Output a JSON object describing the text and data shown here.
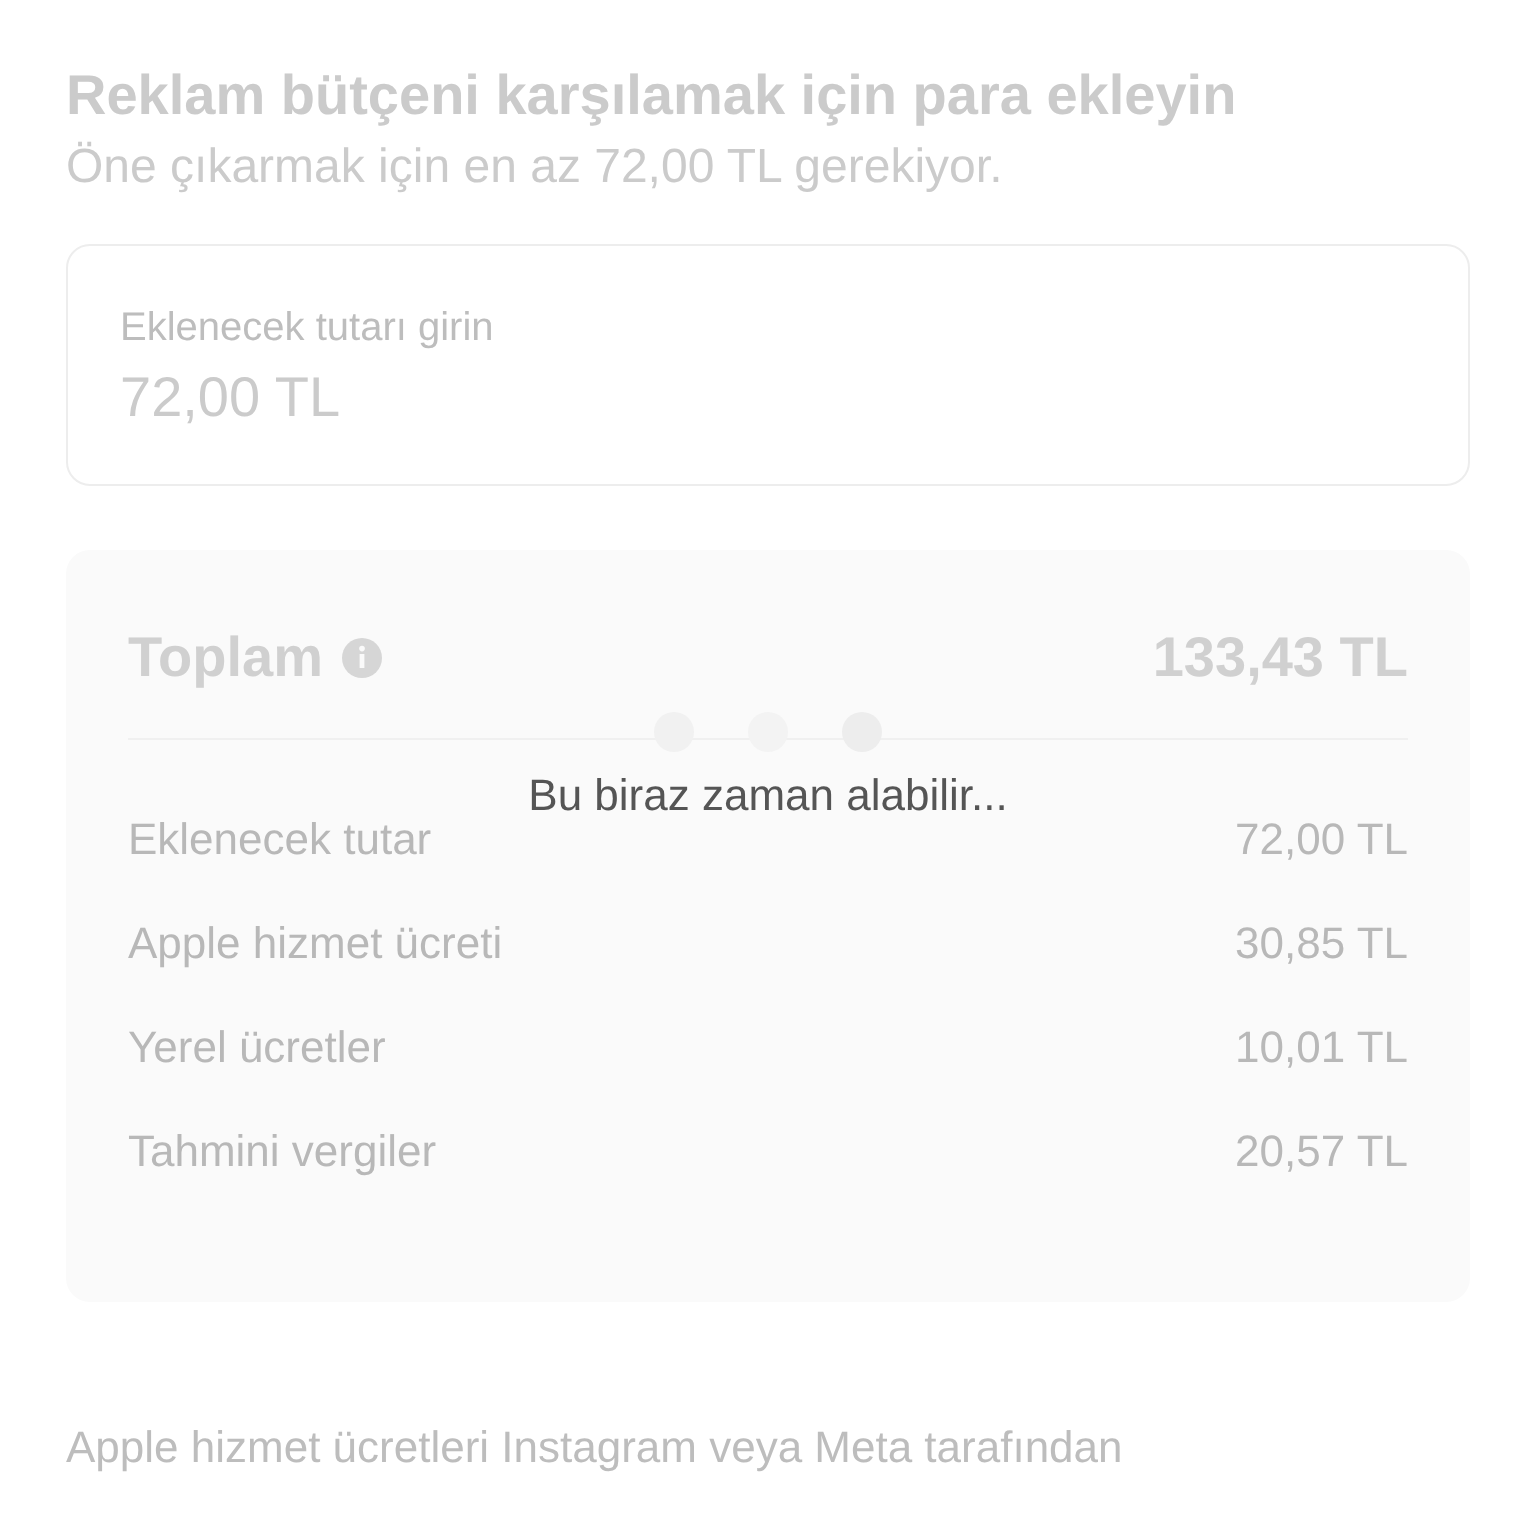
{
  "header": {
    "title": "Reklam bütçeni karşılamak için para ekleyin",
    "subtitle": "Öne çıkarmak için en az 72,00 TL gerekiyor."
  },
  "amount_field": {
    "label": "Eklenecek tutarı girin",
    "value": "72,00 TL"
  },
  "summary": {
    "total_label": "Toplam",
    "total_value": "133,43 TL",
    "rows": [
      {
        "label": "Eklenecek tutar",
        "value": "72,00 TL"
      },
      {
        "label": "Apple hizmet ücreti",
        "value": "30,85 TL"
      },
      {
        "label": "Yerel ücretler",
        "value": "10,01 TL"
      },
      {
        "label": "Tahmini vergiler",
        "value": "20,57 TL"
      }
    ]
  },
  "loading": {
    "message": "Bu biraz zaman alabilir..."
  },
  "footnote": "Apple hizmet ücretleri Instagram veya Meta tarafından"
}
